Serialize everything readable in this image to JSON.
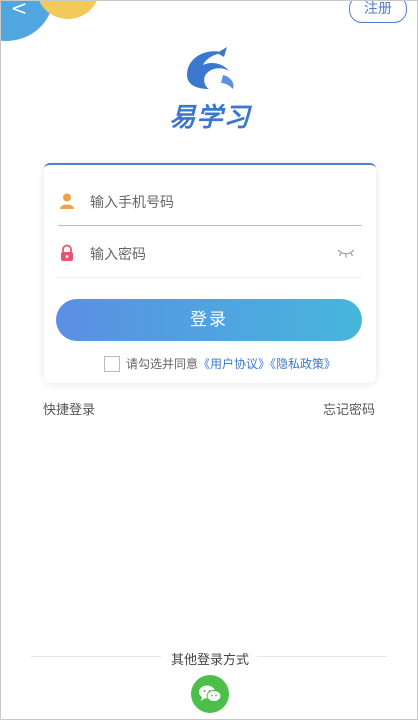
{
  "header": {
    "back_icon": "<",
    "register_label": "注册"
  },
  "brand": {
    "name": "易学习",
    "accent": "#3a78cf"
  },
  "form": {
    "phone_placeholder": "输入手机号码",
    "password_placeholder": "输入密码",
    "login_label": "登录",
    "agreement_prefix": "请勾选并同意",
    "user_agreement": "《用户协议》",
    "privacy_policy": "《隐私政策》"
  },
  "links": {
    "quick_login": "快捷登录",
    "forgot_password": "忘记密码"
  },
  "footer": {
    "other_login_title": "其他登录方式",
    "social_icon": "wechat-icon"
  },
  "colors": {
    "button_gradient_start": "#5b8fe3",
    "button_gradient_end": "#46b6dc",
    "wechat_green": "#4cbf4a"
  }
}
